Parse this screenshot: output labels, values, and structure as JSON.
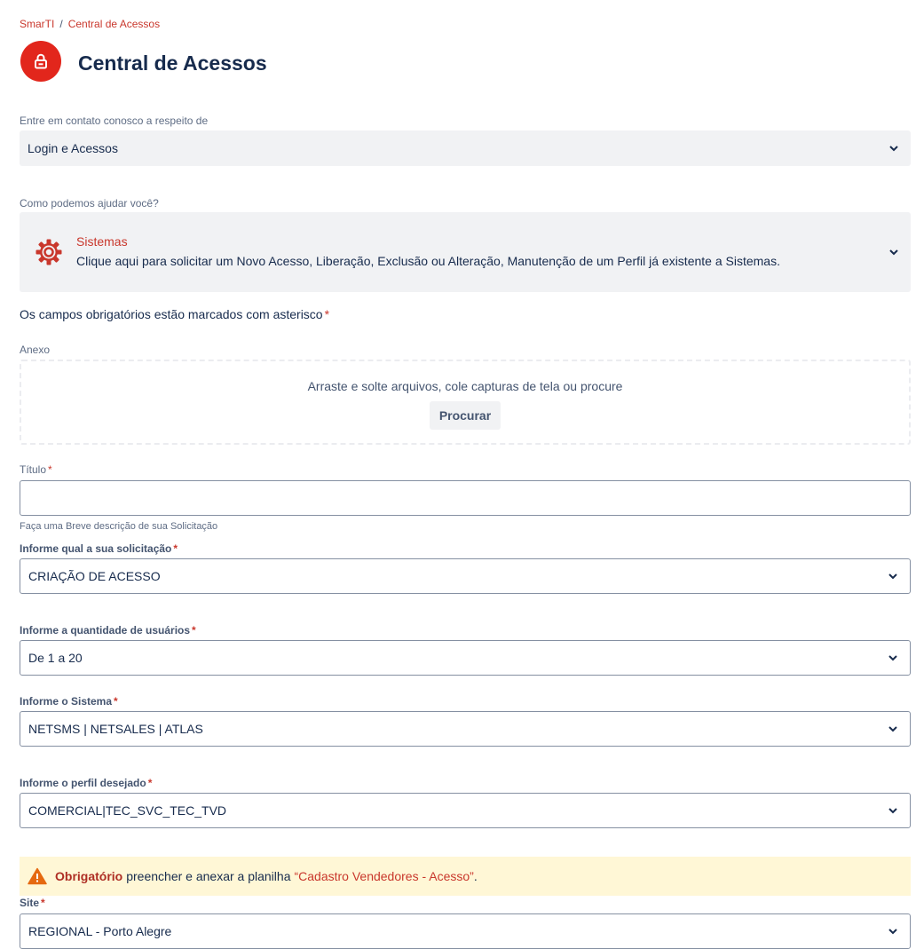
{
  "breadcrumb": {
    "root": "SmarTI",
    "separator": "/",
    "current": "Central de Acessos"
  },
  "page": {
    "title": "Central de Acessos",
    "icon": "lock-icon"
  },
  "contact": {
    "label": "Entre em contato conosco a respeito de",
    "value": "Login e Acessos"
  },
  "help": {
    "label": "Como podemos ajudar você?",
    "request_type": {
      "icon": "gear-icon",
      "title": "Sistemas",
      "description": "Clique aqui para solicitar um Novo Acesso, Liberação, Exclusão ou Alteração, Manutenção de um Perfil já existente a Sistemas."
    }
  },
  "required_note": {
    "text": "Os campos obrigatórios estão marcados com asterisco",
    "asterisk": "*"
  },
  "attachment": {
    "label": "Anexo",
    "drop_text": "Arraste e solte arquivos, cole capturas de tela ou procure",
    "browse_button": "Procurar"
  },
  "fields": {
    "title": {
      "label": "Título",
      "value": "",
      "helper": "Faça uma Breve descrição de sua Solicitação"
    },
    "request": {
      "label": "Informe qual a sua solicitação",
      "value": "CRIAÇÃO DE ACESSO"
    },
    "users": {
      "label": "Informe a quantidade de usuários",
      "value": "De 1 a 20"
    },
    "system": {
      "label": "Informe o Sistema",
      "value": "NETSMS | NETSALES | ATLAS"
    },
    "profile": {
      "label": "Informe o perfil desejado",
      "value": "COMERCIAL|TEC_SVC_TEC_TVD"
    },
    "site": {
      "label": "Site",
      "value": "REGIONAL - Porto Alegre"
    }
  },
  "warning": {
    "icon": "warning-icon",
    "strong": "Obrigatório",
    "text": "preencher e anexar a planilha",
    "link": "“Cadastro Vendedores - Acesso”",
    "end": "."
  },
  "colors": {
    "accent": "#e2261c",
    "link": "#c9372c",
    "warning_bg": "#fff7d6",
    "field_bg": "#f1f2f4"
  }
}
